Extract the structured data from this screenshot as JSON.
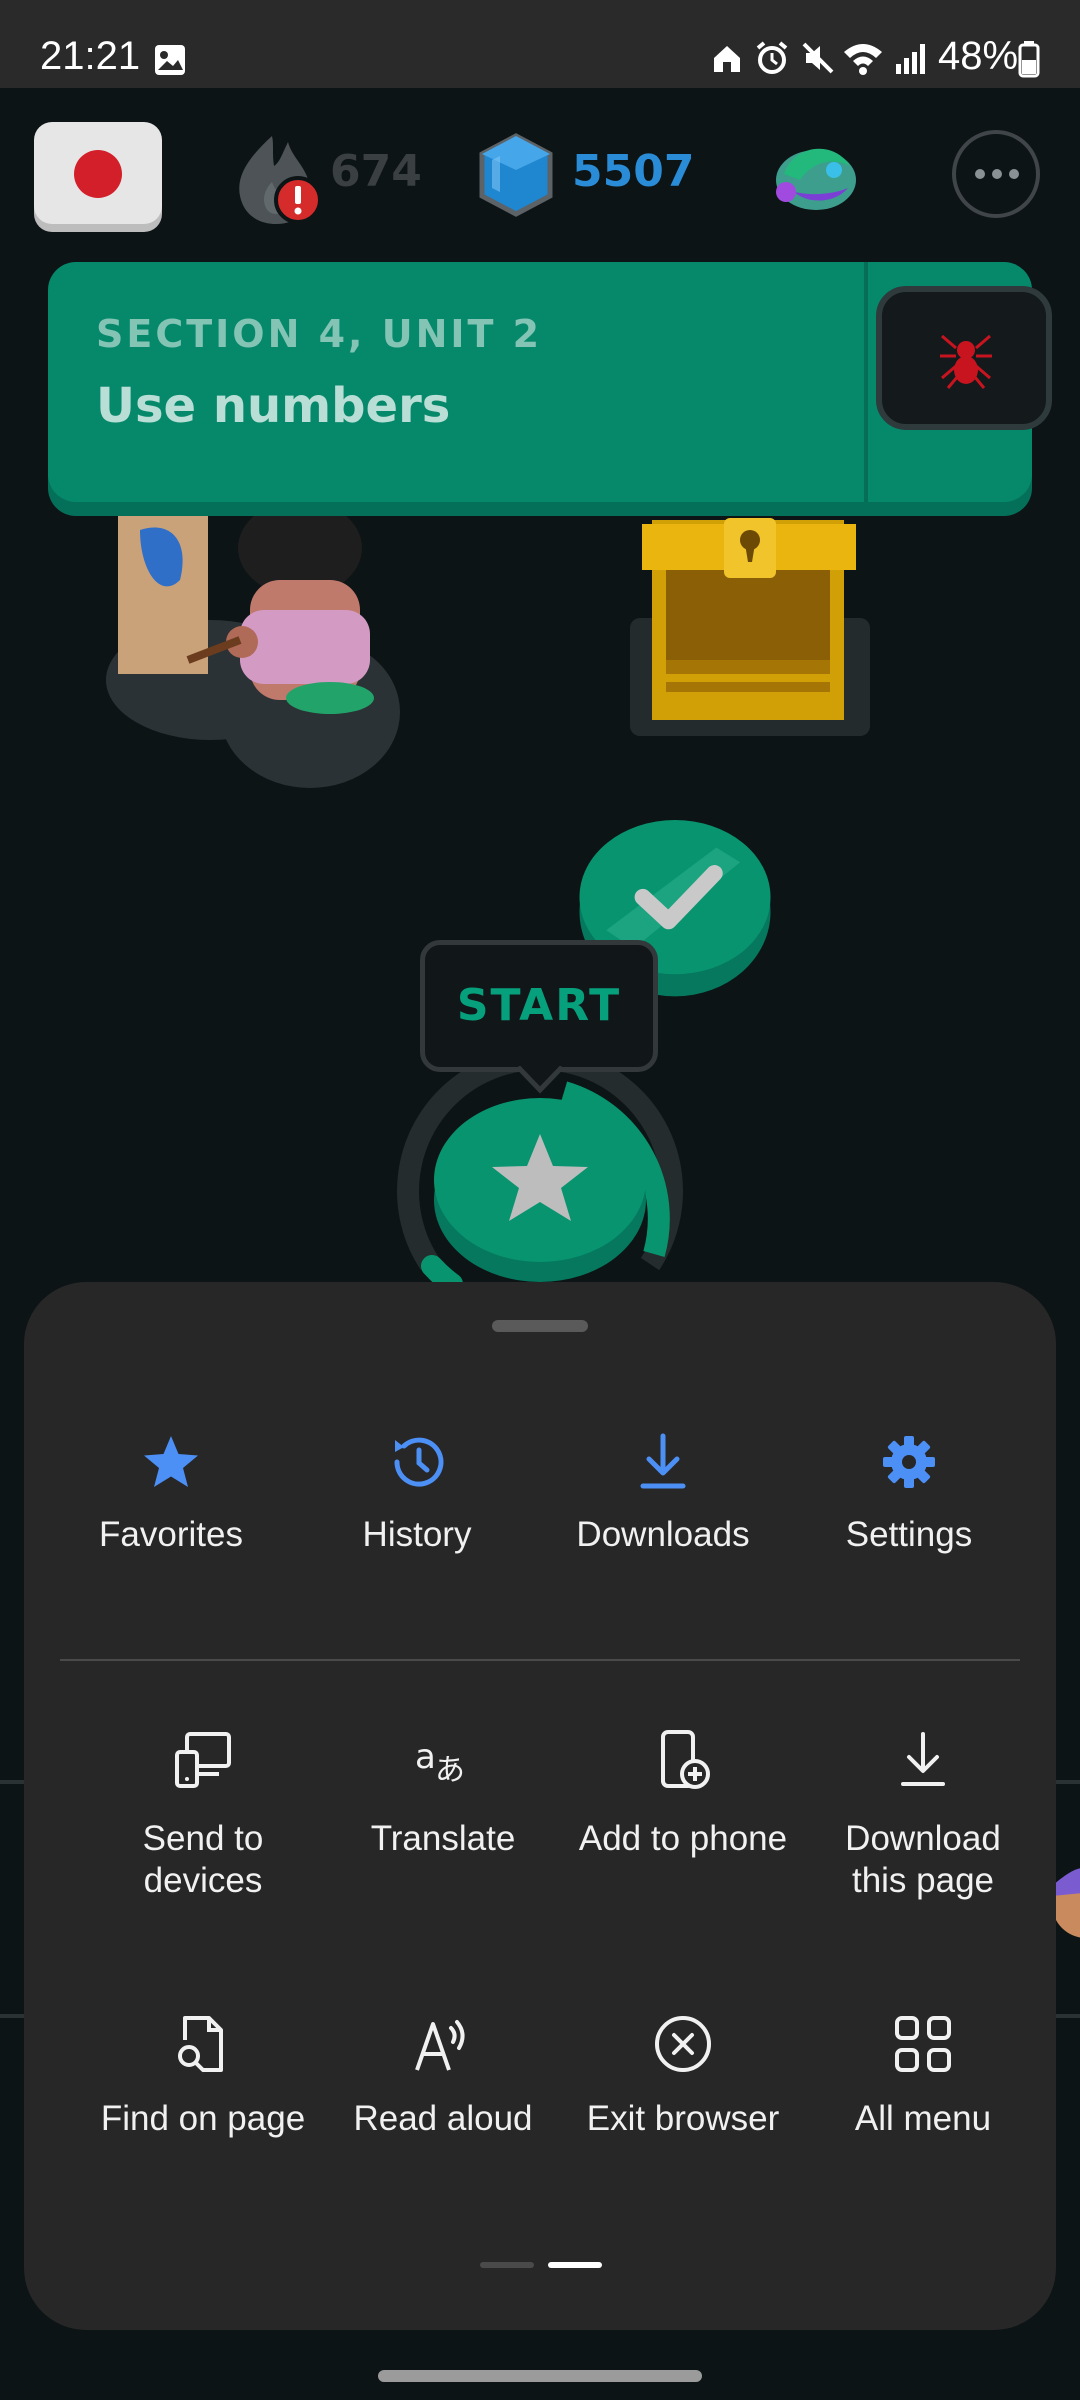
{
  "status_bar": {
    "time": "21:21",
    "battery": "48%",
    "icons": [
      "gallery-icon",
      "home-icon",
      "alarm-icon",
      "mute-icon",
      "wifi-icon",
      "signal-icon",
      "battery-icon"
    ]
  },
  "page": {
    "stats": {
      "streak": "674",
      "gems": "5507"
    },
    "banner": {
      "section": "SECTION 4, UNIT 2",
      "title": "Use numbers"
    },
    "start_label": "START"
  },
  "menu": {
    "top_row": [
      {
        "label": "Favorites",
        "icon": "star-icon"
      },
      {
        "label": "History",
        "icon": "history-icon"
      },
      {
        "label": "Downloads",
        "icon": "download-icon"
      },
      {
        "label": "Settings",
        "icon": "gear-icon"
      }
    ],
    "grid": [
      {
        "label": "Send to devices",
        "line1": "Send to",
        "line2": "devices",
        "icon": "send-to-devices-icon"
      },
      {
        "label": "Translate",
        "line1": "Translate",
        "line2": "",
        "icon": "translate-icon"
      },
      {
        "label": "Add to phone",
        "line1": "Add to phone",
        "line2": "",
        "icon": "add-to-phone-icon"
      },
      {
        "label": "Download this page",
        "line1": "Download",
        "line2": "this page",
        "icon": "download-page-icon"
      },
      {
        "label": "Find on page",
        "line1": "Find on page",
        "line2": "",
        "icon": "find-on-page-icon"
      },
      {
        "label": "Read aloud",
        "line1": "Read aloud",
        "line2": "",
        "icon": "read-aloud-icon"
      },
      {
        "label": "Exit browser",
        "line1": "Exit browser",
        "line2": "",
        "icon": "exit-icon"
      },
      {
        "label": "All menu",
        "line1": "All menu",
        "line2": "",
        "icon": "grid-icon"
      }
    ],
    "accent_color": "#4c8ff5",
    "page_indicator": {
      "pages": 2,
      "current": 2
    }
  }
}
